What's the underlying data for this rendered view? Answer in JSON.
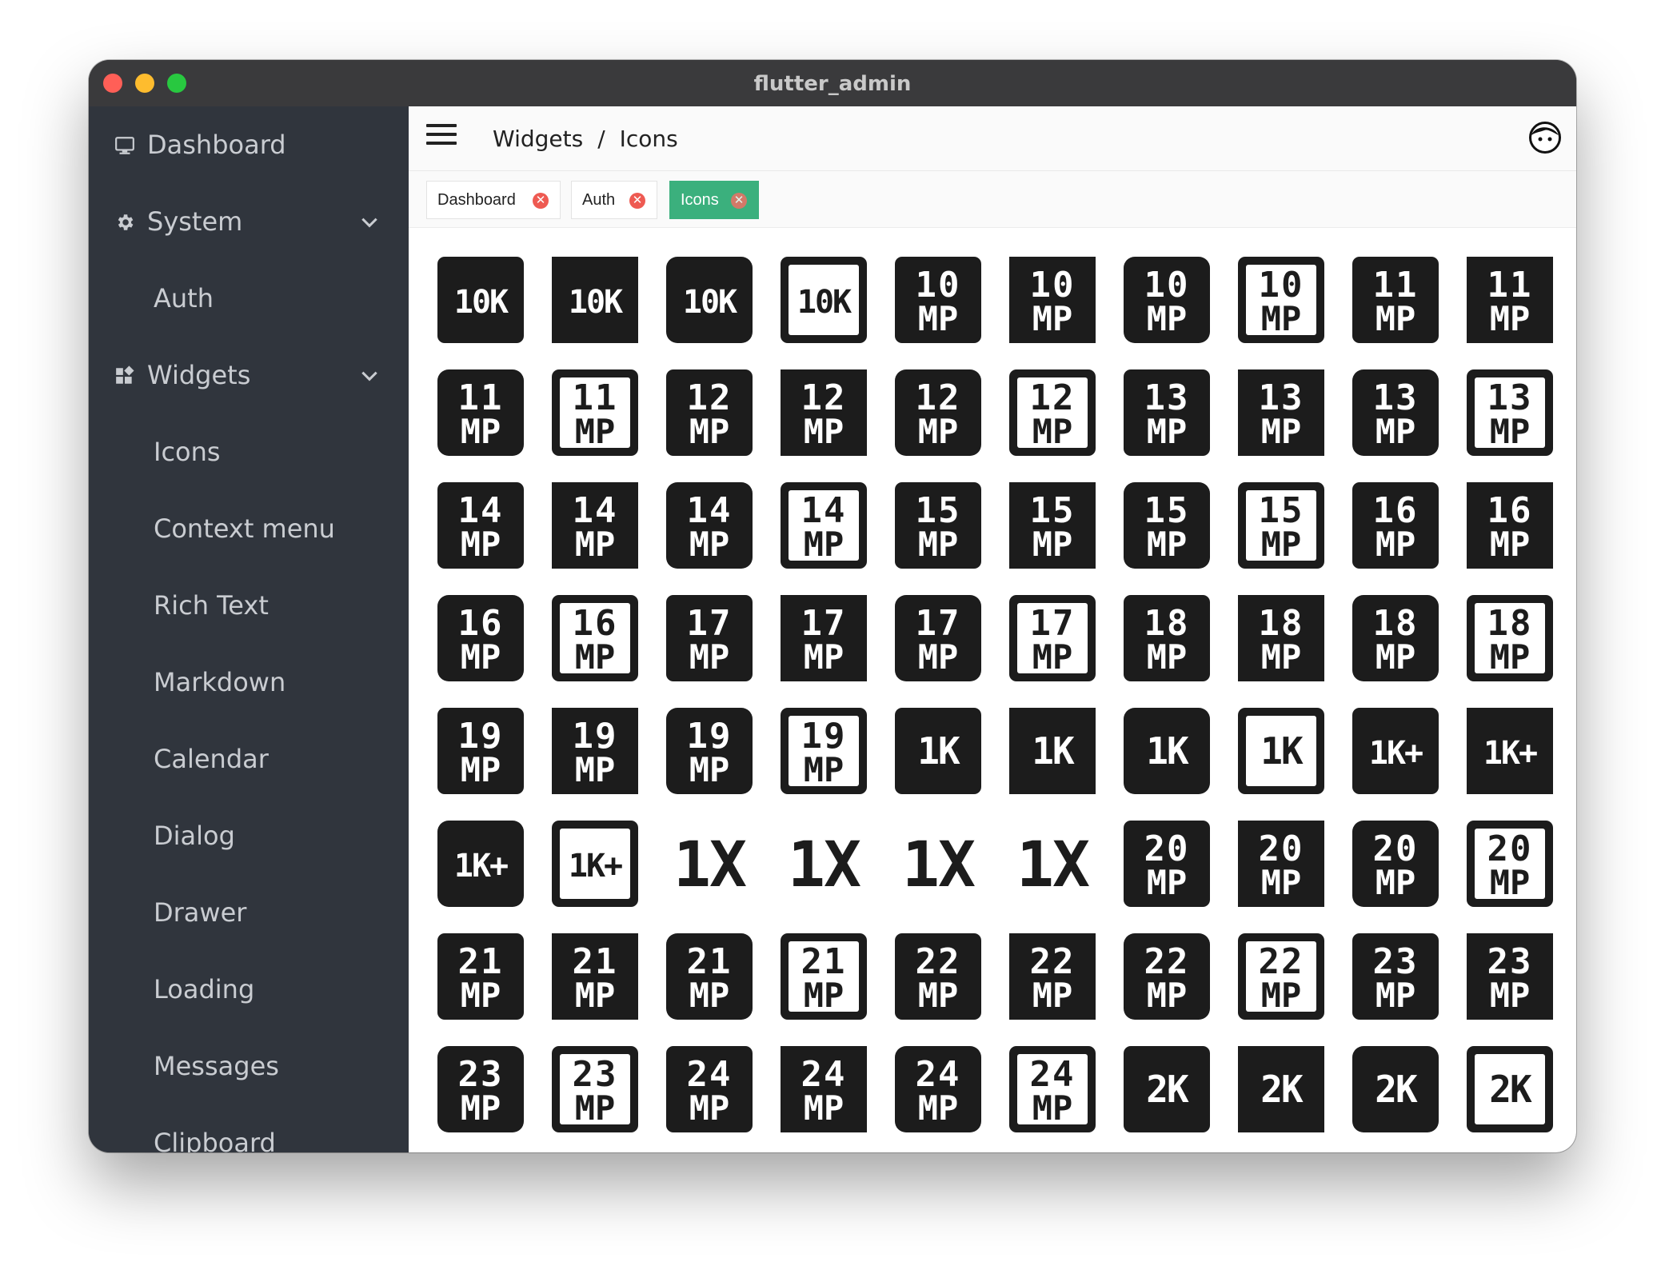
{
  "window": {
    "title": "flutter_admin"
  },
  "sidebar": {
    "items": [
      {
        "label": "Dashboard",
        "icon": "monitor-icon",
        "level": 0
      },
      {
        "label": "System",
        "icon": "gear-icon",
        "level": 0,
        "expandable": true
      },
      {
        "label": "Auth",
        "level": 1
      },
      {
        "label": "Widgets",
        "icon": "widgets-icon",
        "level": 0,
        "expandable": true
      },
      {
        "label": "Icons",
        "level": 1
      },
      {
        "label": "Context menu",
        "level": 1
      },
      {
        "label": "Rich Text",
        "level": 1
      },
      {
        "label": "Markdown",
        "level": 1
      },
      {
        "label": "Calendar",
        "level": 1
      },
      {
        "label": "Dialog",
        "level": 1
      },
      {
        "label": "Drawer",
        "level": 1
      },
      {
        "label": "Loading",
        "level": 1
      },
      {
        "label": "Messages",
        "level": 1
      },
      {
        "label": "Clipboard",
        "level": 1
      }
    ]
  },
  "header": {
    "breadcrumb": {
      "parent": "Widgets",
      "separator": "/",
      "current": "Icons"
    }
  },
  "tabs": [
    {
      "label": "Dashboard",
      "active": false
    },
    {
      "label": "Auth",
      "active": false
    },
    {
      "label": "Icons",
      "active": true
    }
  ],
  "colors": {
    "sidebar_bg": "#30353d",
    "accent": "#3bb07d",
    "close_badge": "#ee5a52",
    "icon_fill": "#1c1c1c"
  },
  "icons": [
    {
      "name": "10k-icon",
      "top": "10K",
      "bottom": "",
      "style": "filled"
    },
    {
      "name": "10k-sharp-icon",
      "top": "10K",
      "bottom": "",
      "style": "sharp"
    },
    {
      "name": "10k-rounded-icon",
      "top": "10K",
      "bottom": "",
      "style": "rounded"
    },
    {
      "name": "10k-outlined-icon",
      "top": "10K",
      "bottom": "",
      "style": "outlined"
    },
    {
      "name": "10mp-icon",
      "top": "10",
      "bottom": "MP",
      "style": "filled"
    },
    {
      "name": "10mp-sharp-icon",
      "top": "10",
      "bottom": "MP",
      "style": "sharp"
    },
    {
      "name": "10mp-rounded-icon",
      "top": "10",
      "bottom": "MP",
      "style": "rounded"
    },
    {
      "name": "10mp-outlined-icon",
      "top": "10",
      "bottom": "MP",
      "style": "outlined"
    },
    {
      "name": "11mp-icon",
      "top": "11",
      "bottom": "MP",
      "style": "filled"
    },
    {
      "name": "11mp-sharp-icon",
      "top": "11",
      "bottom": "MP",
      "style": "sharp"
    },
    {
      "name": "11mp-rounded-icon",
      "top": "11",
      "bottom": "MP",
      "style": "rounded"
    },
    {
      "name": "11mp-outlined-icon",
      "top": "11",
      "bottom": "MP",
      "style": "outlined"
    },
    {
      "name": "12mp-icon",
      "top": "12",
      "bottom": "MP",
      "style": "filled"
    },
    {
      "name": "12mp-sharp-icon",
      "top": "12",
      "bottom": "MP",
      "style": "sharp"
    },
    {
      "name": "12mp-rounded-icon",
      "top": "12",
      "bottom": "MP",
      "style": "rounded"
    },
    {
      "name": "12mp-outlined-icon",
      "top": "12",
      "bottom": "MP",
      "style": "outlined"
    },
    {
      "name": "13mp-icon",
      "top": "13",
      "bottom": "MP",
      "style": "filled"
    },
    {
      "name": "13mp-sharp-icon",
      "top": "13",
      "bottom": "MP",
      "style": "sharp"
    },
    {
      "name": "13mp-rounded-icon",
      "top": "13",
      "bottom": "MP",
      "style": "rounded"
    },
    {
      "name": "13mp-outlined-icon",
      "top": "13",
      "bottom": "MP",
      "style": "outlined"
    },
    {
      "name": "14mp-icon",
      "top": "14",
      "bottom": "MP",
      "style": "filled"
    },
    {
      "name": "14mp-sharp-icon",
      "top": "14",
      "bottom": "MP",
      "style": "sharp"
    },
    {
      "name": "14mp-rounded-icon",
      "top": "14",
      "bottom": "MP",
      "style": "rounded"
    },
    {
      "name": "14mp-outlined-icon",
      "top": "14",
      "bottom": "MP",
      "style": "outlined"
    },
    {
      "name": "15mp-icon",
      "top": "15",
      "bottom": "MP",
      "style": "filled"
    },
    {
      "name": "15mp-sharp-icon",
      "top": "15",
      "bottom": "MP",
      "style": "sharp"
    },
    {
      "name": "15mp-rounded-icon",
      "top": "15",
      "bottom": "MP",
      "style": "rounded"
    },
    {
      "name": "15mp-outlined-icon",
      "top": "15",
      "bottom": "MP",
      "style": "outlined"
    },
    {
      "name": "16mp-icon",
      "top": "16",
      "bottom": "MP",
      "style": "filled"
    },
    {
      "name": "16mp-sharp-icon",
      "top": "16",
      "bottom": "MP",
      "style": "sharp"
    },
    {
      "name": "16mp-rounded-icon",
      "top": "16",
      "bottom": "MP",
      "style": "rounded"
    },
    {
      "name": "16mp-outlined-icon",
      "top": "16",
      "bottom": "MP",
      "style": "outlined"
    },
    {
      "name": "17mp-icon",
      "top": "17",
      "bottom": "MP",
      "style": "filled"
    },
    {
      "name": "17mp-sharp-icon",
      "top": "17",
      "bottom": "MP",
      "style": "sharp"
    },
    {
      "name": "17mp-rounded-icon",
      "top": "17",
      "bottom": "MP",
      "style": "rounded"
    },
    {
      "name": "17mp-outlined-icon",
      "top": "17",
      "bottom": "MP",
      "style": "outlined"
    },
    {
      "name": "18mp-icon",
      "top": "18",
      "bottom": "MP",
      "style": "filled"
    },
    {
      "name": "18mp-sharp-icon",
      "top": "18",
      "bottom": "MP",
      "style": "sharp"
    },
    {
      "name": "18mp-rounded-icon",
      "top": "18",
      "bottom": "MP",
      "style": "rounded"
    },
    {
      "name": "18mp-outlined-icon",
      "top": "18",
      "bottom": "MP",
      "style": "outlined"
    },
    {
      "name": "19mp-icon",
      "top": "19",
      "bottom": "MP",
      "style": "filled"
    },
    {
      "name": "19mp-sharp-icon",
      "top": "19",
      "bottom": "MP",
      "style": "sharp"
    },
    {
      "name": "19mp-rounded-icon",
      "top": "19",
      "bottom": "MP",
      "style": "rounded"
    },
    {
      "name": "19mp-outlined-icon",
      "top": "19",
      "bottom": "MP",
      "style": "outlined"
    },
    {
      "name": "1k-icon",
      "top": "1K",
      "bottom": "",
      "style": "filled"
    },
    {
      "name": "1k-sharp-icon",
      "top": "1K",
      "bottom": "",
      "style": "sharp"
    },
    {
      "name": "1k-rounded-icon",
      "top": "1K",
      "bottom": "",
      "style": "rounded"
    },
    {
      "name": "1k-outlined-icon",
      "top": "1K",
      "bottom": "",
      "style": "outlined"
    },
    {
      "name": "1k-plus-icon",
      "top": "1K+",
      "bottom": "",
      "style": "filled"
    },
    {
      "name": "1k-plus-sharp-icon",
      "top": "1K+",
      "bottom": "",
      "style": "sharp"
    },
    {
      "name": "1k-plus-rounded-icon",
      "top": "1K+",
      "bottom": "",
      "style": "rounded"
    },
    {
      "name": "1k-plus-outlined-icon",
      "top": "1K+",
      "bottom": "",
      "style": "outlined"
    },
    {
      "name": "1x-icon",
      "top": "1X",
      "bottom": "",
      "style": "plain"
    },
    {
      "name": "1x-sharp-icon",
      "top": "1X",
      "bottom": "",
      "style": "plain"
    },
    {
      "name": "1x-rounded-icon",
      "top": "1X",
      "bottom": "",
      "style": "plain"
    },
    {
      "name": "1x-outlined-icon",
      "top": "1X",
      "bottom": "",
      "style": "plain"
    },
    {
      "name": "20mp-icon",
      "top": "20",
      "bottom": "MP",
      "style": "filled"
    },
    {
      "name": "20mp-sharp-icon",
      "top": "20",
      "bottom": "MP",
      "style": "sharp"
    },
    {
      "name": "20mp-rounded-icon",
      "top": "20",
      "bottom": "MP",
      "style": "rounded"
    },
    {
      "name": "20mp-outlined-icon",
      "top": "20",
      "bottom": "MP",
      "style": "outlined"
    },
    {
      "name": "21mp-icon",
      "top": "21",
      "bottom": "MP",
      "style": "filled"
    },
    {
      "name": "21mp-sharp-icon",
      "top": "21",
      "bottom": "MP",
      "style": "sharp"
    },
    {
      "name": "21mp-rounded-icon",
      "top": "21",
      "bottom": "MP",
      "style": "rounded"
    },
    {
      "name": "21mp-outlined-icon",
      "top": "21",
      "bottom": "MP",
      "style": "outlined"
    },
    {
      "name": "22mp-icon",
      "top": "22",
      "bottom": "MP",
      "style": "filled"
    },
    {
      "name": "22mp-sharp-icon",
      "top": "22",
      "bottom": "MP",
      "style": "sharp"
    },
    {
      "name": "22mp-rounded-icon",
      "top": "22",
      "bottom": "MP",
      "style": "rounded"
    },
    {
      "name": "22mp-outlined-icon",
      "top": "22",
      "bottom": "MP",
      "style": "outlined"
    },
    {
      "name": "23mp-icon",
      "top": "23",
      "bottom": "MP",
      "style": "filled"
    },
    {
      "name": "23mp-sharp-icon",
      "top": "23",
      "bottom": "MP",
      "style": "sharp"
    },
    {
      "name": "23mp-rounded-icon",
      "top": "23",
      "bottom": "MP",
      "style": "rounded"
    },
    {
      "name": "23mp-outlined-icon",
      "top": "23",
      "bottom": "MP",
      "style": "outlined"
    },
    {
      "name": "24mp-icon",
      "top": "24",
      "bottom": "MP",
      "style": "filled"
    },
    {
      "name": "24mp-sharp-icon",
      "top": "24",
      "bottom": "MP",
      "style": "sharp"
    },
    {
      "name": "24mp-rounded-icon",
      "top": "24",
      "bottom": "MP",
      "style": "rounded"
    },
    {
      "name": "24mp-outlined-icon",
      "top": "24",
      "bottom": "MP",
      "style": "outlined"
    },
    {
      "name": "2k-icon",
      "top": "2K",
      "bottom": "",
      "style": "filled"
    },
    {
      "name": "2k-sharp-icon",
      "top": "2K",
      "bottom": "",
      "style": "sharp"
    },
    {
      "name": "2k-rounded-icon",
      "top": "2K",
      "bottom": "",
      "style": "rounded"
    },
    {
      "name": "2k-outlined-icon",
      "top": "2K",
      "bottom": "",
      "style": "outlined"
    }
  ]
}
